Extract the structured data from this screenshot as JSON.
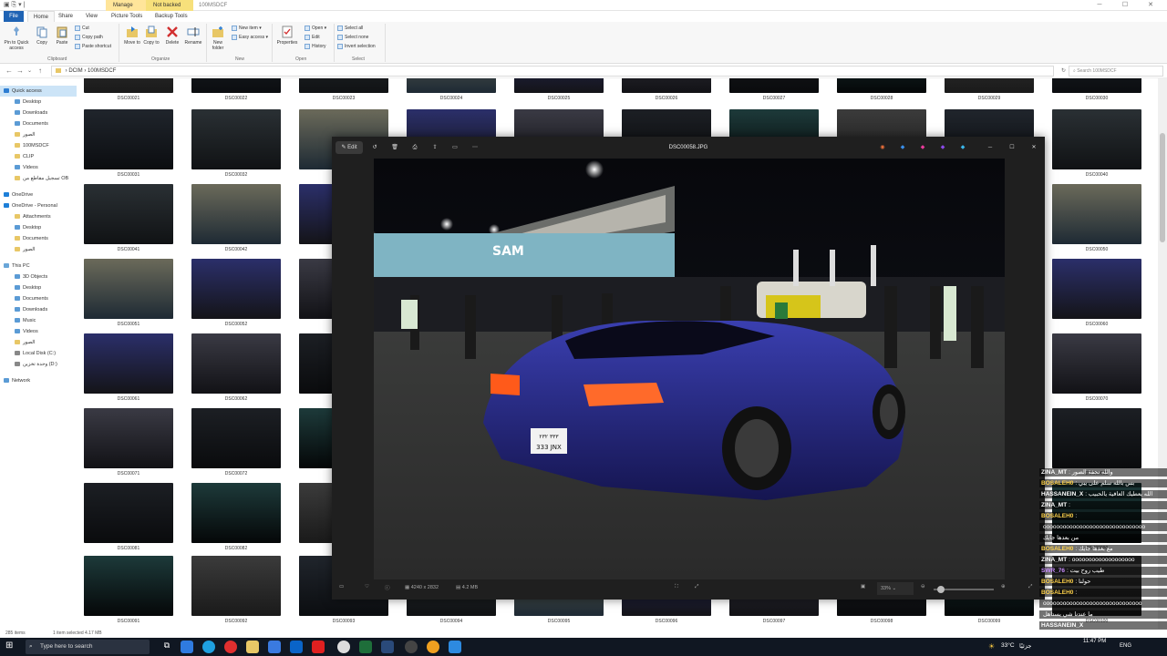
{
  "titlebar": {
    "contextual_tabs": [
      "Manage",
      "Not backed up"
    ],
    "folder_name": "100MSDCF"
  },
  "ribbon": {
    "tabs": [
      "File",
      "Home",
      "Share",
      "View",
      "Picture Tools",
      "Backup Tools"
    ],
    "clipboard": {
      "pin": "Pin to Quick access",
      "copy": "Copy",
      "paste": "Paste",
      "cut": "Cut",
      "copy_path": "Copy path",
      "paste_shortcut": "Paste shortcut",
      "group": "Clipboard"
    },
    "organize": {
      "move": "Move to",
      "copy": "Copy to",
      "delete": "Delete",
      "rename": "Rename",
      "group": "Organize"
    },
    "new": {
      "new_folder": "New folder",
      "new_item": "New item",
      "easy_access": "Easy access",
      "group": "New"
    },
    "open": {
      "properties": "Properties",
      "open": "Open",
      "edit": "Edit",
      "history": "History",
      "group": "Open"
    },
    "select": {
      "select_all": "Select all",
      "select_none": "Select none",
      "invert": "Invert selection",
      "group": "Select"
    }
  },
  "address": {
    "path": [
      "DCIM",
      "100MSDCF"
    ],
    "search_placeholder": "Search 100MSDCF"
  },
  "nav": {
    "items": [
      {
        "label": "Quick access",
        "type": "star"
      },
      {
        "label": "Desktop",
        "type": "blue"
      },
      {
        "label": "Downloads",
        "type": "blue"
      },
      {
        "label": "Documents",
        "type": "blue"
      },
      {
        "label": "الصور",
        "type": "folder"
      },
      {
        "label": "100MSDCF",
        "type": "folder"
      },
      {
        "label": "CLIP",
        "type": "folder"
      },
      {
        "label": "Videos",
        "type": "blue"
      },
      {
        "label": "تسجيل مقاطع من OB",
        "type": "folder"
      },
      {
        "label": "OneDrive",
        "type": "cloud"
      },
      {
        "label": "OneDrive - Personal",
        "type": "cloud"
      },
      {
        "label": "Attachments",
        "type": "folder"
      },
      {
        "label": "Desktop",
        "type": "blue"
      },
      {
        "label": "Documents",
        "type": "folder"
      },
      {
        "label": "الصور",
        "type": "folder"
      },
      {
        "label": "This PC",
        "type": "pc"
      },
      {
        "label": "3D Objects",
        "type": "blue"
      },
      {
        "label": "Desktop",
        "type": "blue"
      },
      {
        "label": "Documents",
        "type": "blue"
      },
      {
        "label": "Downloads",
        "type": "blue"
      },
      {
        "label": "Music",
        "type": "blue"
      },
      {
        "label": "Videos",
        "type": "blue"
      },
      {
        "label": "الصور",
        "type": "folder"
      },
      {
        "label": "Local Disk (C:)",
        "type": "disk"
      },
      {
        "label": "وحدة تخزين (D:)",
        "type": "disk"
      },
      {
        "label": "Network",
        "type": "net"
      }
    ]
  },
  "files": {
    "rows": [
      [
        "DSC00021",
        "DSC00022",
        "DSC00023",
        "DSC00024",
        "DSC00025",
        "DSC00026",
        "DSC00027",
        "DSC00028",
        "DSC00029",
        "DSC00030"
      ],
      [
        "DSC00031",
        "DSC00032",
        "",
        "",
        "",
        "",
        "",
        "",
        "",
        "DSC00040"
      ],
      [
        "DSC00041",
        "DSC00042",
        "",
        "",
        "",
        "",
        "",
        "",
        "",
        "DSC00050"
      ],
      [
        "DSC00051",
        "DSC00052",
        "",
        "",
        "",
        "",
        "",
        "",
        "",
        "DSC00060"
      ],
      [
        "DSC00061",
        "DSC00062",
        "",
        "",
        "",
        "",
        "",
        "",
        "",
        "DSC00070"
      ],
      [
        "DSC00071",
        "DSC00072",
        "",
        "",
        "",
        "",
        "",
        "",
        "",
        "DSC00080"
      ],
      [
        "DSC00081",
        "DSC00082",
        "",
        "",
        "",
        "",
        "",
        "",
        "",
        "DSC00090"
      ],
      [
        "DSC00091",
        "DSC00092",
        "DSC00093",
        "DSC00094",
        "DSC00095",
        "DSC00096",
        "DSC00097",
        "DSC00098",
        "DSC00099",
        "DSC00100"
      ]
    ]
  },
  "status": {
    "count": "285 items",
    "selected": "1 item selected  4.17 MB"
  },
  "viewer": {
    "edit": "Edit",
    "filename": "DSC00058.JPG",
    "dimensions": "4240 x 2832",
    "size": "4.2 MB",
    "zoom": "33%",
    "plate_line1": "٣٣٣ ٢٣٢",
    "plate_line2": "333 JNX"
  },
  "taskbar": {
    "search_placeholder": "Type here to search",
    "temp": "33°C",
    "weather": "جزئيًا",
    "time": "11:47 PM",
    "lang": "ENG"
  },
  "chat": {
    "lines": [
      {
        "name": "ZINA_MT",
        "text": ": والله تحفة الصور",
        "color": "#ffffff"
      },
      {
        "name": "BOSALEH0",
        "text": ": بس بالله سلم على يبي",
        "color": "#ffd24a"
      },
      {
        "name": "HASSANEIN_X",
        "text": ": الله يعطيك العافية يالحبيب",
        "color": "#ffffff"
      },
      {
        "name": "ZINA_MT",
        "text": ":",
        "color": "#ffffff"
      },
      {
        "name": "BOSALEH0",
        "text": ":",
        "color": "#ffd24a"
      },
      {
        "name": "",
        "text": "ooooooooooooooooooooooooooooooo",
        "color": "#ffffff"
      },
      {
        "name": "",
        "text": "من بعدها جايك",
        "color": "#ffffff"
      },
      {
        "name": "BOSALEH0",
        "text": ": مع بعدها جايك",
        "color": "#ffd24a"
      },
      {
        "name": "ZINA_MT",
        "text": ": ooooooooooooooooooo",
        "color": "#ffffff"
      },
      {
        "name": "SWR_76",
        "text": ": طيب روح بيت",
        "color": "#c98cff"
      },
      {
        "name": "BOSALEH0",
        "text": ": حولنا",
        "color": "#ffd24a"
      },
      {
        "name": "BOSALEH0",
        "text": ":",
        "color": "#ffd24a"
      },
      {
        "name": "",
        "text": "oooooooooooooooooooooooooooooo",
        "color": "#ffffff"
      },
      {
        "name": "",
        "text": "ما عندنا شي يستاهل",
        "color": "#ffffff"
      },
      {
        "name": "HASSANEIN_X",
        "text": "",
        "color": "#ffffff"
      }
    ]
  }
}
